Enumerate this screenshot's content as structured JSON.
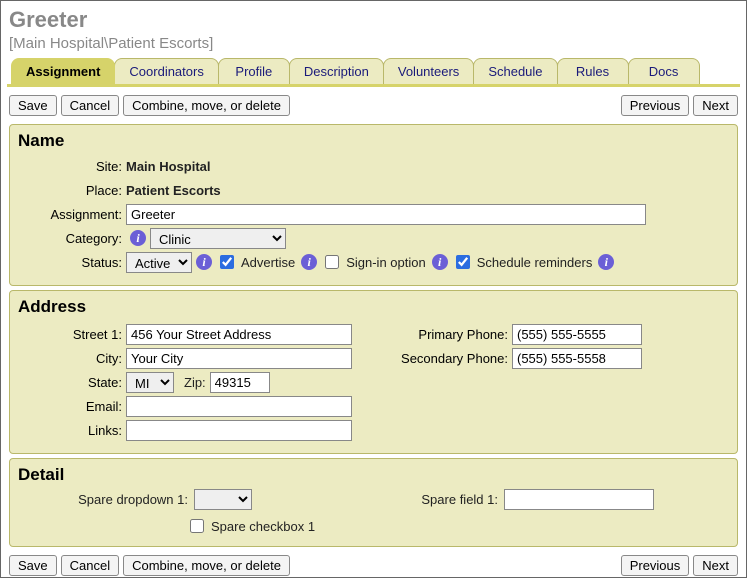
{
  "header": {
    "title": "Greeter",
    "breadcrumb": "[Main Hospital\\Patient Escorts]"
  },
  "tabs": [
    {
      "label": "Assignment",
      "active": true
    },
    {
      "label": "Coordinators",
      "active": false
    },
    {
      "label": "Profile",
      "active": false
    },
    {
      "label": "Description",
      "active": false
    },
    {
      "label": "Volunteers",
      "active": false
    },
    {
      "label": "Schedule",
      "active": false
    },
    {
      "label": "Rules",
      "active": false
    },
    {
      "label": "Docs",
      "active": false
    }
  ],
  "buttons": {
    "save": "Save",
    "cancel": "Cancel",
    "combine": "Combine, move, or delete",
    "previous": "Previous",
    "next": "Next"
  },
  "name_panel": {
    "heading": "Name",
    "site_label": "Site:",
    "site_value": "Main Hospital",
    "place_label": "Place:",
    "place_value": "Patient Escorts",
    "assignment_label": "Assignment:",
    "assignment_value": "Greeter",
    "category_label": "Category:",
    "category_value": "Clinic",
    "status_label": "Status:",
    "status_value": "Active",
    "advertise_label": "Advertise",
    "advertise_checked": true,
    "signin_label": "Sign-in option",
    "signin_checked": false,
    "reminders_label": "Schedule reminders",
    "reminders_checked": true
  },
  "address_panel": {
    "heading": "Address",
    "street1_label": "Street 1:",
    "street1_value": "456 Your Street Address",
    "city_label": "City:",
    "city_value": "Your City",
    "state_label": "State:",
    "state_value": "MI",
    "zip_label": "Zip:",
    "zip_value": "49315",
    "email_label": "Email:",
    "email_value": "",
    "links_label": "Links:",
    "links_value": "",
    "primary_label": "Primary Phone:",
    "primary_value": "(555) 555-5555",
    "secondary_label": "Secondary Phone:",
    "secondary_value": "(555) 555-5558"
  },
  "detail_panel": {
    "heading": "Detail",
    "spare_dd_label": "Spare dropdown 1:",
    "spare_dd_value": "",
    "spare_field_label": "Spare field 1:",
    "spare_field_value": "",
    "spare_cb_label": "Spare checkbox 1",
    "spare_cb_checked": false
  }
}
